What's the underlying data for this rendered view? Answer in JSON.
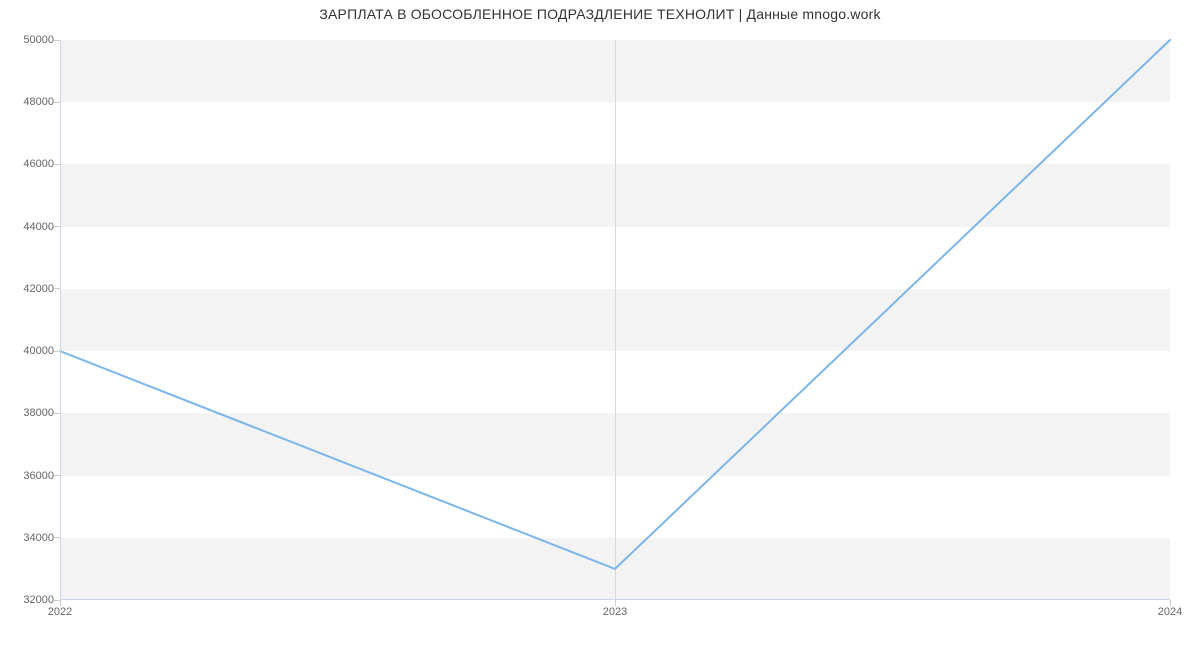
{
  "chart_data": {
    "type": "line",
    "title": "ЗАРПЛАТА В ОБОСОБЛЕННОЕ ПОДРАЗДЛЕНИЕ ТЕХНОЛИТ | Данные mnogo.work",
    "xlabel": "",
    "ylabel": "",
    "categories": [
      "2022",
      "2023",
      "2024"
    ],
    "values": [
      40000,
      33000,
      50000
    ],
    "xlim": [
      "2022",
      "2024"
    ],
    "ylim": [
      32000,
      50000
    ],
    "y_ticks": [
      32000,
      34000,
      36000,
      38000,
      40000,
      42000,
      44000,
      46000,
      48000,
      50000
    ],
    "x_ticks": [
      "2022",
      "2023",
      "2024"
    ],
    "line_color": "#7cb5ec",
    "band_color": "#f3f3f3"
  },
  "labels": {
    "y_32000": "32000",
    "y_34000": "34000",
    "y_36000": "36000",
    "y_38000": "38000",
    "y_40000": "40000",
    "y_42000": "42000",
    "y_44000": "44000",
    "y_46000": "46000",
    "y_48000": "48000",
    "y_50000": "50000",
    "x_2022": "2022",
    "x_2023": "2023",
    "x_2024": "2024"
  }
}
